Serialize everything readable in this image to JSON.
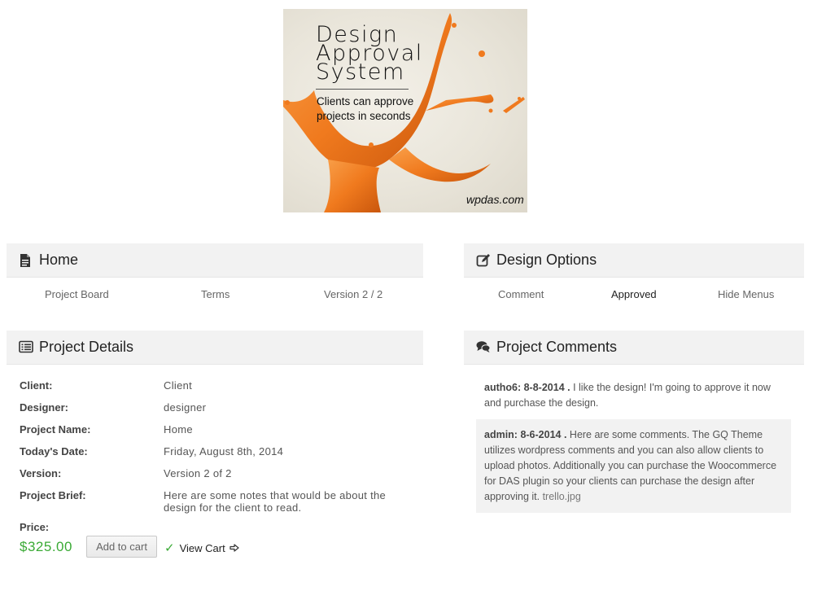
{
  "banner": {
    "title_lines": [
      "Design",
      "Approval",
      "System"
    ],
    "subtitle_lines": [
      "Clients can approve",
      "projects in seconds"
    ],
    "url": "wpdas.com",
    "accent_color": "#f07a1e"
  },
  "home_panel": {
    "title": "Home",
    "icon": "file-icon",
    "nav": [
      "Project Board",
      "Terms",
      "Version 2 / 2"
    ]
  },
  "design_options": {
    "title": "Design Options",
    "icon": "edit-icon",
    "nav": [
      "Comment",
      "Approved",
      "Hide Menus"
    ]
  },
  "project_details": {
    "title": "Project Details",
    "icon": "list-icon",
    "rows": [
      {
        "label": "Client:",
        "value": "Client"
      },
      {
        "label": "Designer:",
        "value": "designer"
      },
      {
        "label": "Project Name:",
        "value": "Home"
      },
      {
        "label": "Today's Date:",
        "value": "Friday, August 8th, 2014"
      },
      {
        "label": "Version:",
        "value": "Version 2 of 2"
      },
      {
        "label": "Project Brief:",
        "value": "Here are some notes that would be about the design for the client to read."
      }
    ],
    "price_label": "Price:",
    "price": "$325.00",
    "add_to_cart": "Add to cart",
    "view_cart": "View Cart",
    "price_color": "#3aaa35"
  },
  "project_comments": {
    "title": "Project Comments",
    "icon": "comments-icon",
    "comments": [
      {
        "author": "autho6: 8-8-2014 .",
        "text": " I like the design! I'm going to approve it now and purchase the design.",
        "attachment": ""
      },
      {
        "author": "admin: 8-6-2014 .",
        "text": " Here are some comments. The GQ Theme utilizes wordpress comments and you can also allow clients to upload photos. Additionally you can purchase the Woocommerce for DAS plugin so your clients can purchase the design after approving it. ",
        "attachment": "trello.jpg"
      }
    ]
  }
}
